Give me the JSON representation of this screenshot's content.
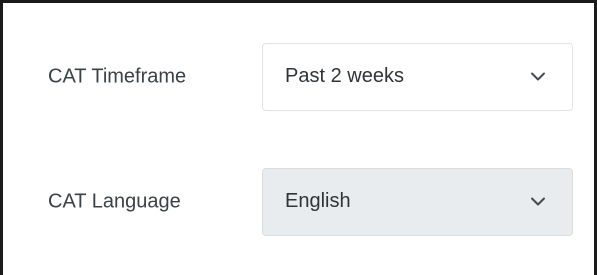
{
  "form": {
    "timeframe": {
      "label": "CAT Timeframe",
      "selected": "Past 2 weeks",
      "icon": "chevron-down-icon"
    },
    "language": {
      "label": "CAT Language",
      "selected": "English",
      "icon": "chevron-down-icon"
    }
  },
  "colors": {
    "label_text": "#3b4148",
    "value_text": "#2f3439",
    "select_border": "#dfe3e8",
    "disabled_background": "#e9ecef",
    "frame_border": "#1a1a1a"
  }
}
